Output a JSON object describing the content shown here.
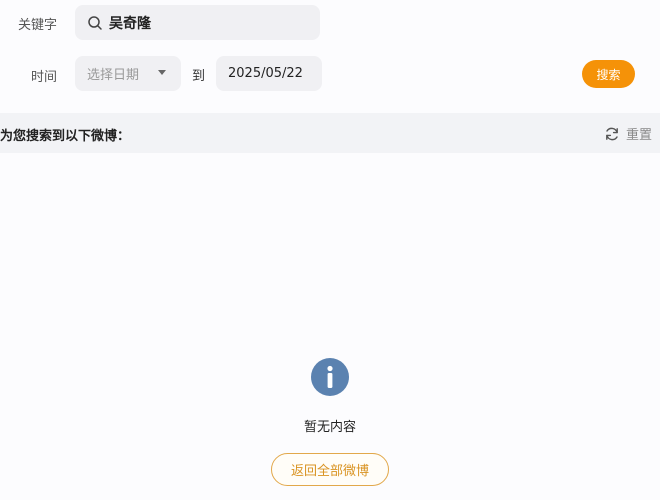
{
  "filters": {
    "keyword_label": "关键字",
    "keyword_value": "吴奇隆",
    "time_label": "时间",
    "date_start_placeholder": "选择日期",
    "to_label": "到",
    "date_end_value": "2025/05/22",
    "search_label": "搜索"
  },
  "results": {
    "title": "为您搜索到以下微博：",
    "reset_label": "重置"
  },
  "empty_state": {
    "message": "暂无内容",
    "back_label": "返回全部微博"
  },
  "colors": {
    "accent": "#f59208",
    "info_icon": "#5b82b0",
    "back_button_border": "#e2a84a"
  },
  "icons": [
    "search-icon",
    "caret-down-icon",
    "refresh-icon",
    "info-icon"
  ]
}
